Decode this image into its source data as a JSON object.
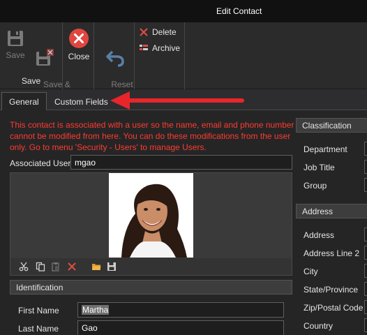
{
  "window": {
    "title": "Edit Contact"
  },
  "ribbon": {
    "save_label": "Save",
    "save_close_label": "Save &\nClose",
    "group_label": "Save",
    "close_label": "Close",
    "reset_label": "Reset\nChanges",
    "delete_label": "Delete",
    "archive_label": "Archive"
  },
  "tabs": [
    {
      "label": "General",
      "active": true
    },
    {
      "label": "Custom Fields",
      "active": false
    }
  ],
  "notice": "This contact is associated with a user so the name, email and phone number cannot be modified from here. You can do these modifications from the user only. Go to menu 'Security - Users' to manage Users.",
  "associated_user": {
    "label": "Associated User",
    "value": "mgao"
  },
  "photo_tools": [
    "cut-icon",
    "copy-icon",
    "paste-icon",
    "delete-icon",
    "open-folder-icon",
    "save-icon"
  ],
  "identification": {
    "header": "Identification",
    "first_name_label": "First Name",
    "first_name_value": "Martha",
    "last_name_label": "Last Name",
    "last_name_value": "Gao"
  },
  "classification": {
    "header": "Classification",
    "fields": [
      "Department",
      "Job Title",
      "Group"
    ]
  },
  "address": {
    "header": "Address",
    "fields": [
      "Address",
      "Address Line 2",
      "City",
      "State/Province",
      "Zip/Postal Code",
      "Country"
    ]
  },
  "colors": {
    "notice": "#ff3b30",
    "close_button": "#e0463f",
    "annotation_arrow": "#e8262a"
  }
}
